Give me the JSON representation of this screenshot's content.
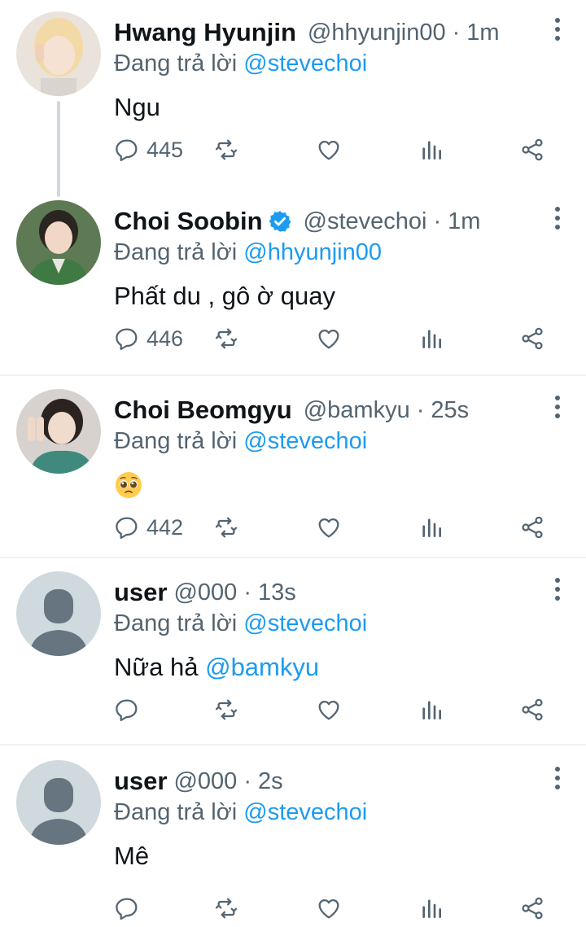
{
  "reply_prefix": "Đang trả lời",
  "tweets": [
    {
      "name": "Hwang Hyunjin",
      "handle": "@hhyunjin00",
      "separator": "·",
      "time": "1m",
      "replying_to": "@stevechoi",
      "text": "Ngu",
      "reply_count": "445",
      "verified": false
    },
    {
      "name": "Choi Soobin",
      "handle": "@stevechoi",
      "separator": "·",
      "time": "1m",
      "replying_to": "@hhyunjin00",
      "text": "Phất du , gô ờ quay",
      "reply_count": "446",
      "verified": true
    },
    {
      "name": "Choi Beomgyu",
      "handle": "@bamkyu",
      "separator": "·",
      "time": "25s",
      "replying_to": "@stevechoi",
      "text": "",
      "emoji": "pleading-face",
      "reply_count": "442",
      "verified": false
    },
    {
      "name": "user",
      "handle": "@000",
      "separator": "·",
      "time": "13s",
      "replying_to": "@stevechoi",
      "text": "Nữa hả ",
      "text_mention": "@bamkyu",
      "reply_count": "",
      "verified": false
    },
    {
      "name": "user",
      "handle": "@000",
      "separator": "·",
      "time": "2s",
      "replying_to": "@stevechoi",
      "text": "Mê",
      "reply_count": "",
      "verified": false
    }
  ],
  "colors": {
    "accent": "#1d9bf0",
    "secondary_text": "#536471",
    "primary_text": "#0f1419",
    "divider": "#eff3f4",
    "default_avatar_bg": "#cfd9de",
    "default_avatar_fg": "#66757f"
  },
  "icons": [
    "reply-icon",
    "retweet-icon",
    "like-icon",
    "analytics-icon",
    "share-icon",
    "more-icon",
    "verified-badge-icon"
  ]
}
